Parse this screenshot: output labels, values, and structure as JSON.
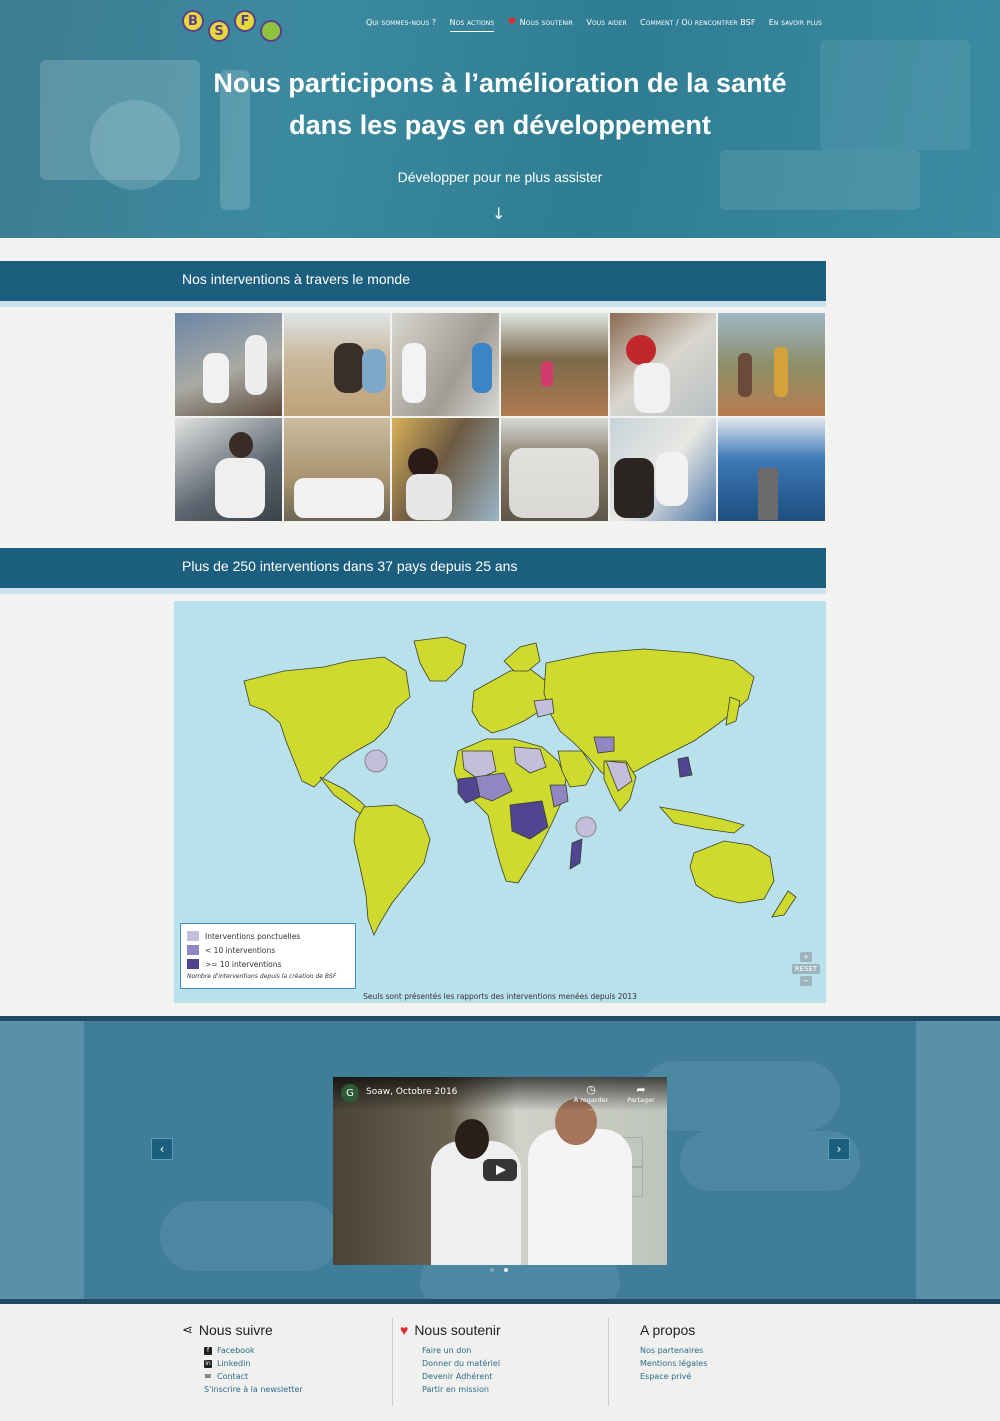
{
  "logo": {
    "letters": [
      "B",
      "S",
      "F"
    ]
  },
  "nav": {
    "items": [
      {
        "label": "Qui sommes-nous ?"
      },
      {
        "label": "Nos actions"
      },
      {
        "label": "Nous soutenir"
      },
      {
        "label": "Vous aider"
      },
      {
        "label": "Comment / Où rencontrer BSF"
      },
      {
        "label": "En savoir plus"
      }
    ]
  },
  "hero": {
    "title_line1": "Nous participons à l’amélioration de la santé",
    "title_line2": "dans les pays en développement",
    "subtitle": "Développer pour ne plus assister",
    "arrow": "↓"
  },
  "sections": {
    "interventions_title": "Nos interventions à travers le monde",
    "stats_title": "Plus de 250 interventions dans 37 pays depuis 25 ans"
  },
  "map": {
    "legend": [
      {
        "label": "Interventions ponctuelles",
        "color": "#c4bedb"
      },
      {
        "label": "< 10 interventions",
        "color": "#8f86c2"
      },
      {
        "label": ">= 10 interventions",
        "color": "#4f4590"
      }
    ],
    "legend_note": "Nombre d'interventions depuis la création de BSF",
    "controls": {
      "zoom_in": "+",
      "reset": "RESET",
      "zoom_out": "−"
    },
    "footnote": "Seuls sont présentés les rapports des interventions menées depuis 2013",
    "colors": {
      "ocean": "#b8e1ec",
      "land": "#cedb2e",
      "border": "#3a3f2a"
    }
  },
  "video": {
    "channel_initial": "G",
    "title": "Soaw, Octobre 2016",
    "watch_later": "À regarder ...",
    "share": "Partager",
    "prev": "‹",
    "next": "›"
  },
  "footer": {
    "follow": {
      "title": "Nous suivre",
      "items": [
        {
          "label": "Facebook",
          "icon": "f"
        },
        {
          "label": "Linkedin",
          "icon": "in"
        },
        {
          "label": "Contact",
          "icon": "✉"
        },
        {
          "label": "S'inscrire à la newsletter"
        }
      ]
    },
    "support": {
      "title": "Nous soutenir",
      "items": [
        "Faire un don",
        "Donner du matériel",
        "Devenir Adhérent",
        "Partir en mission"
      ]
    },
    "about": {
      "title": "A propos",
      "items": [
        "Nos partenaires",
        "Mentions légales",
        "Espace privé"
      ]
    }
  }
}
